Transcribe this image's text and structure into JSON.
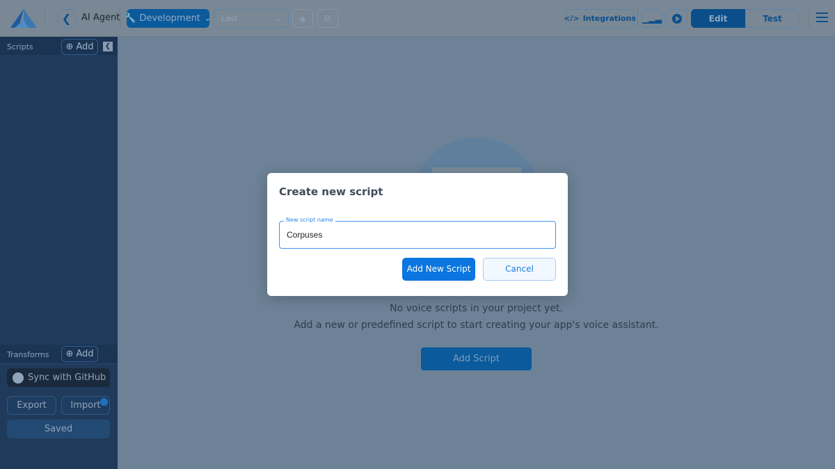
{
  "header": {
    "app_title": "AI Agent",
    "environment": "Development",
    "version_select": "Last",
    "integrations": "Integrations",
    "edit": "Edit",
    "test": "Test"
  },
  "sidebar": {
    "scripts_label": "Scripts",
    "add": "Add",
    "transforms_label": "Transforms",
    "sync": "Sync with GitHub",
    "export": "Export",
    "import": "Import",
    "saved": "Saved"
  },
  "main": {
    "empty_title": "No voice scripts in your project yet.",
    "empty_sub": "Add a new or predefined script to start creating your app's voice assistant.",
    "add_script": "Add Script"
  },
  "dialog": {
    "title": "Create new script",
    "field_label": "New script name",
    "field_value": "Corpuses",
    "primary": "Add New Script",
    "cancel": "Cancel"
  },
  "colors": {
    "accent": "#0b76e0",
    "sidebar": "#1f3a5a"
  }
}
